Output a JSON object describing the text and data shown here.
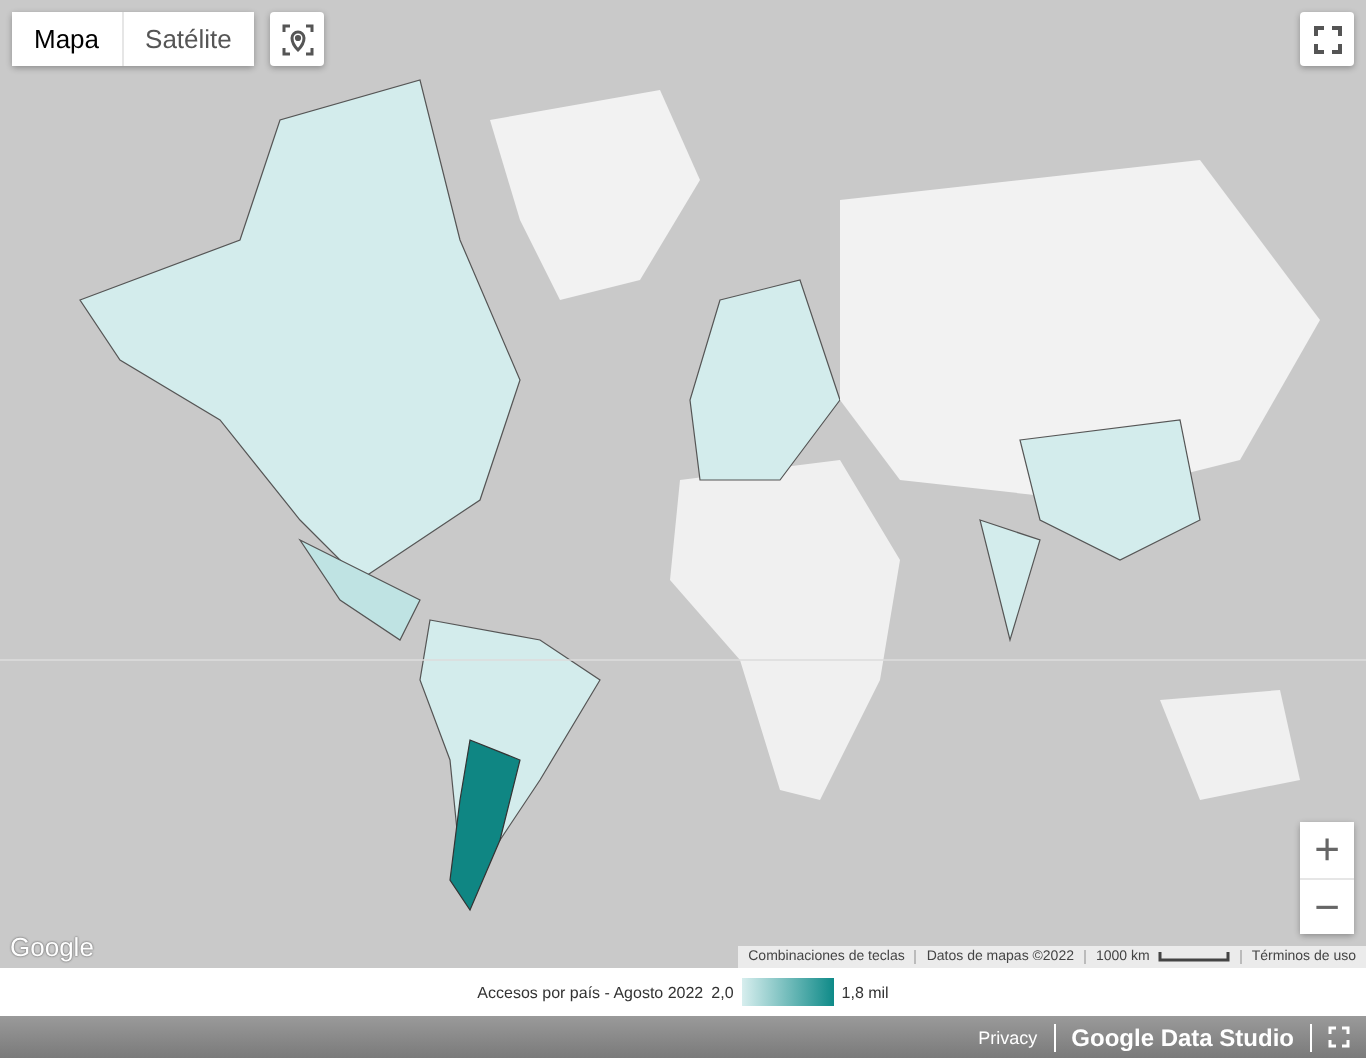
{
  "map_type_tabs": [
    {
      "label": "Mapa",
      "selected": true
    },
    {
      "label": "Satélite",
      "selected": false
    }
  ],
  "logo": "Google",
  "attribution": [
    {
      "kind": "text",
      "label": "Combinaciones de teclas"
    },
    {
      "kind": "text",
      "label": "Datos de mapas ©2022"
    },
    {
      "kind": "scale",
      "label": "1000 km"
    },
    {
      "kind": "text",
      "label": "Términos de uso"
    }
  ],
  "zoom": {
    "in": "+",
    "out": "−"
  },
  "legend": {
    "title": "Accesos por país - Agosto 2022",
    "min": "2,0",
    "max": "1,8 mil"
  },
  "footer": {
    "privacy": "Privacy",
    "brand": "Google Data Studio"
  }
}
